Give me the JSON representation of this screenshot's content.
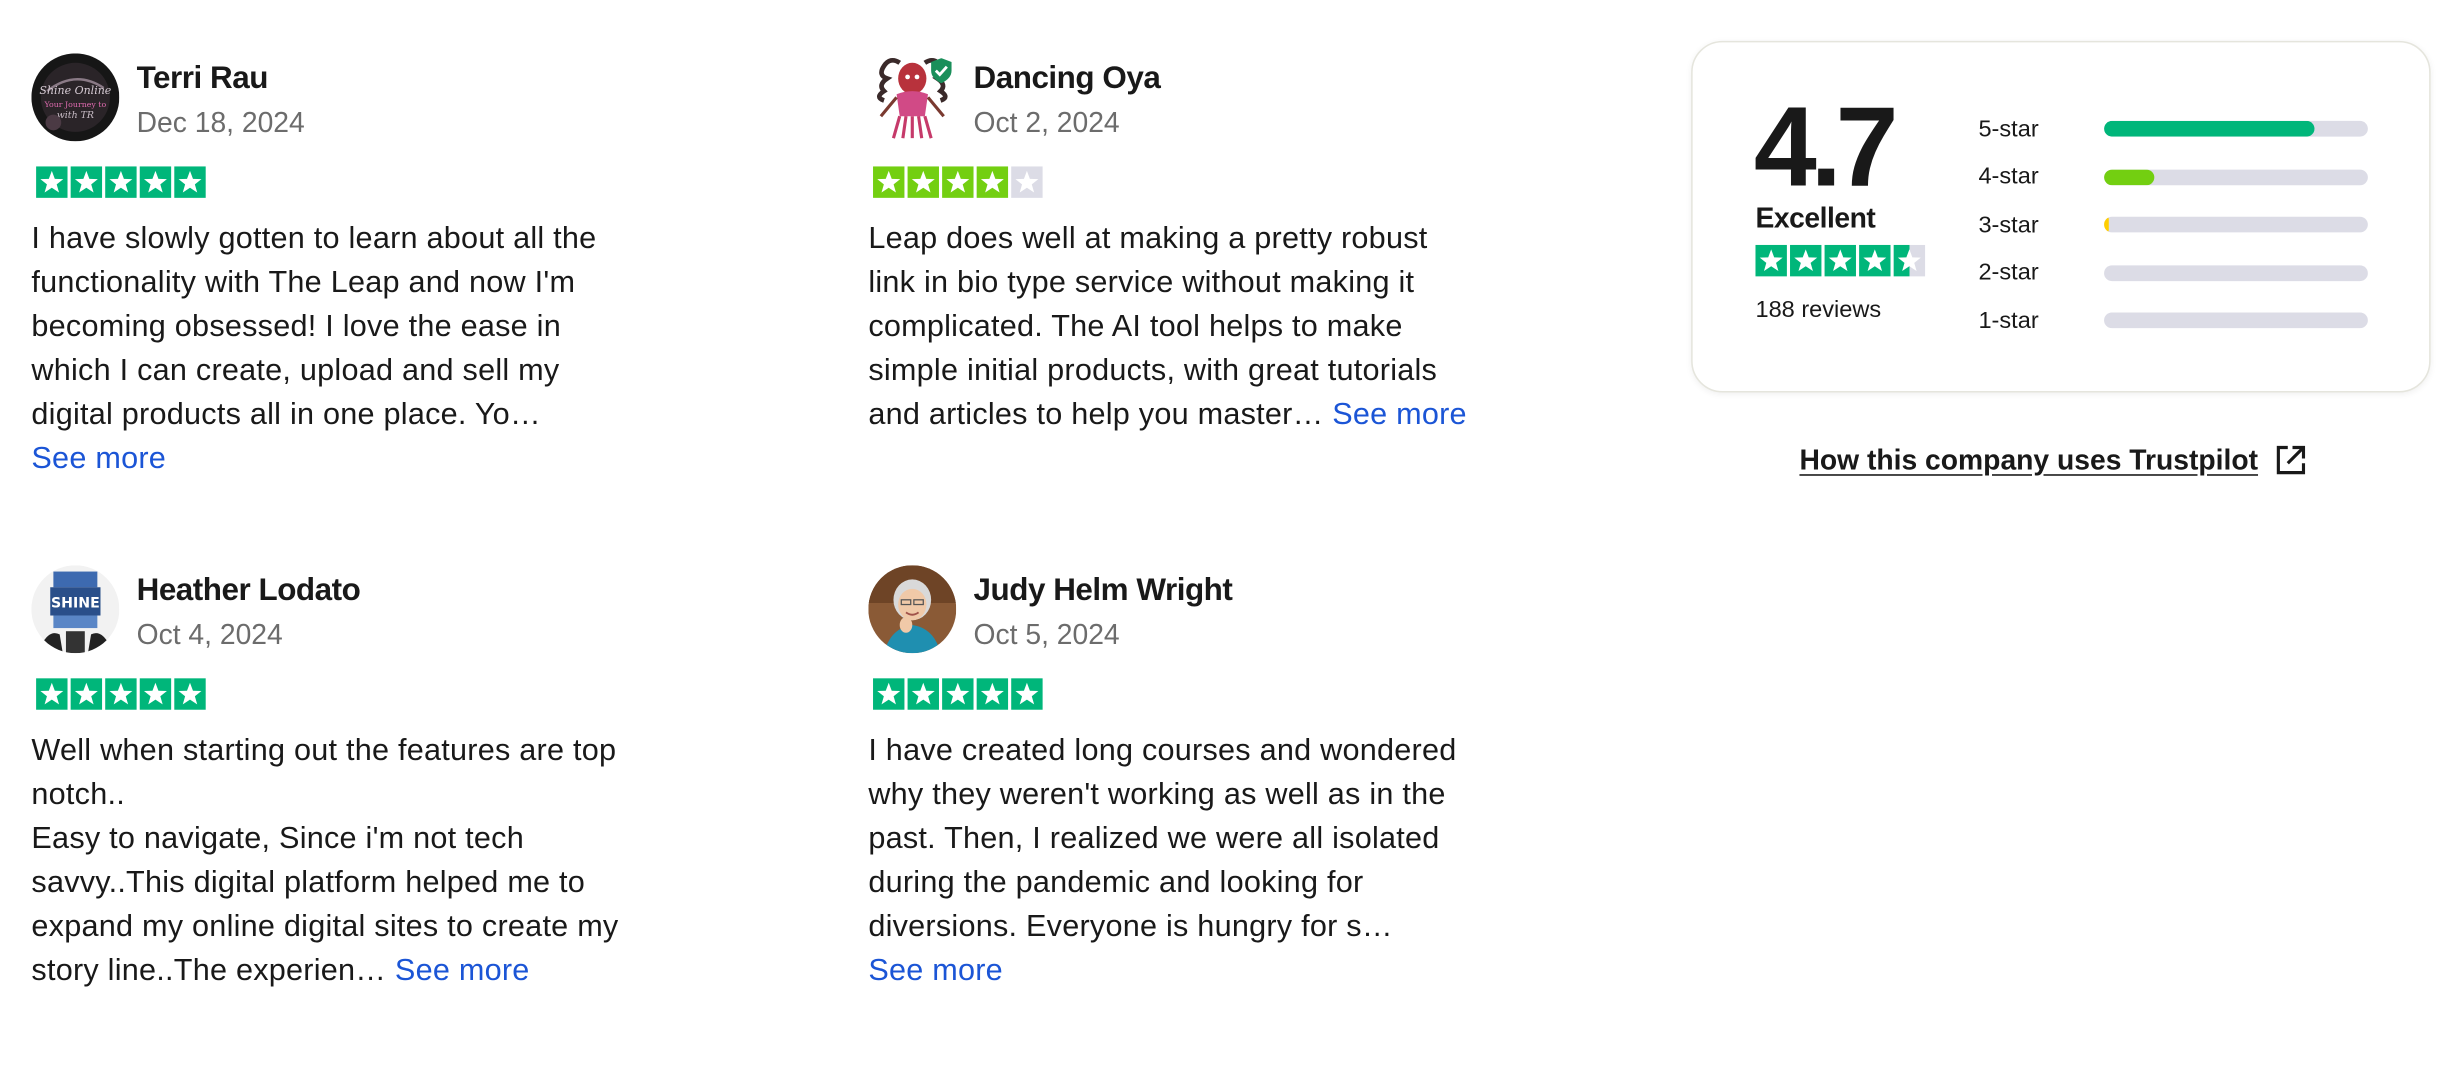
{
  "reviews": [
    {
      "name": "Terri Rau",
      "date": "Dec 18, 2024",
      "rating": 5,
      "text": "I have slowly gotten to learn about all the\nfunctionality with The Leap and now I'm\nbecoming obsessed! I love the ease in\nwhich I can create, upload and sell my\ndigital products all in one place. Yo…\n",
      "see_more": "See more"
    },
    {
      "name": "Dancing Oya",
      "date": "Oct 2, 2024",
      "rating": 4,
      "text": "Leap does well at making a pretty robust\nlink in bio type service without making it\ncomplicated. The AI tool helps to make\nsimple initial products, with great tutorials\nand articles to help you master… ",
      "see_more": "See more"
    },
    {
      "name": "Heather Lodato",
      "date": "Oct 4, 2024",
      "rating": 5,
      "text": "Well when starting out the features are top\nnotch..\nEasy to navigate, Since i'm not tech\nsavvy..This digital platform helped me to\nexpand my online digital sites to create my\nstory line..The experien… ",
      "see_more": "See more"
    },
    {
      "name": "Judy Helm Wright",
      "date": "Oct 5, 2024",
      "rating": 5,
      "text": "I have created long courses and wondered\nwhy they weren't working as well as in the\npast. Then, I realized we were all isolated\nduring the pandemic and looking for\ndiversions. Everyone is hungry for s…\n",
      "see_more": "See more"
    }
  ],
  "summary": {
    "score": "4.7",
    "label": "Excellent",
    "rating": 4.5,
    "reviews_count": "188 reviews",
    "distribution": [
      {
        "label": "5-star",
        "fraction": 0.8,
        "color": "#00b67a"
      },
      {
        "label": "4-star",
        "fraction": 0.19,
        "color": "#73cf11"
      },
      {
        "label": "3-star",
        "fraction": 0.015,
        "color": "#ffce00"
      },
      {
        "label": "2-star",
        "fraction": 0.0,
        "color": "#ff8622"
      },
      {
        "label": "1-star",
        "fraction": 0.0,
        "color": "#ff3722"
      }
    ]
  },
  "trustpilot_link": "How this company uses Trustpilot",
  "colors": {
    "five_star": "#00b67a",
    "four_star": "#73cf11",
    "empty_star": "#dcdce6",
    "link": "#1b55d6"
  },
  "icons": {
    "star": "star-icon",
    "external": "external-link-icon",
    "verified": "verified-badge-icon"
  }
}
